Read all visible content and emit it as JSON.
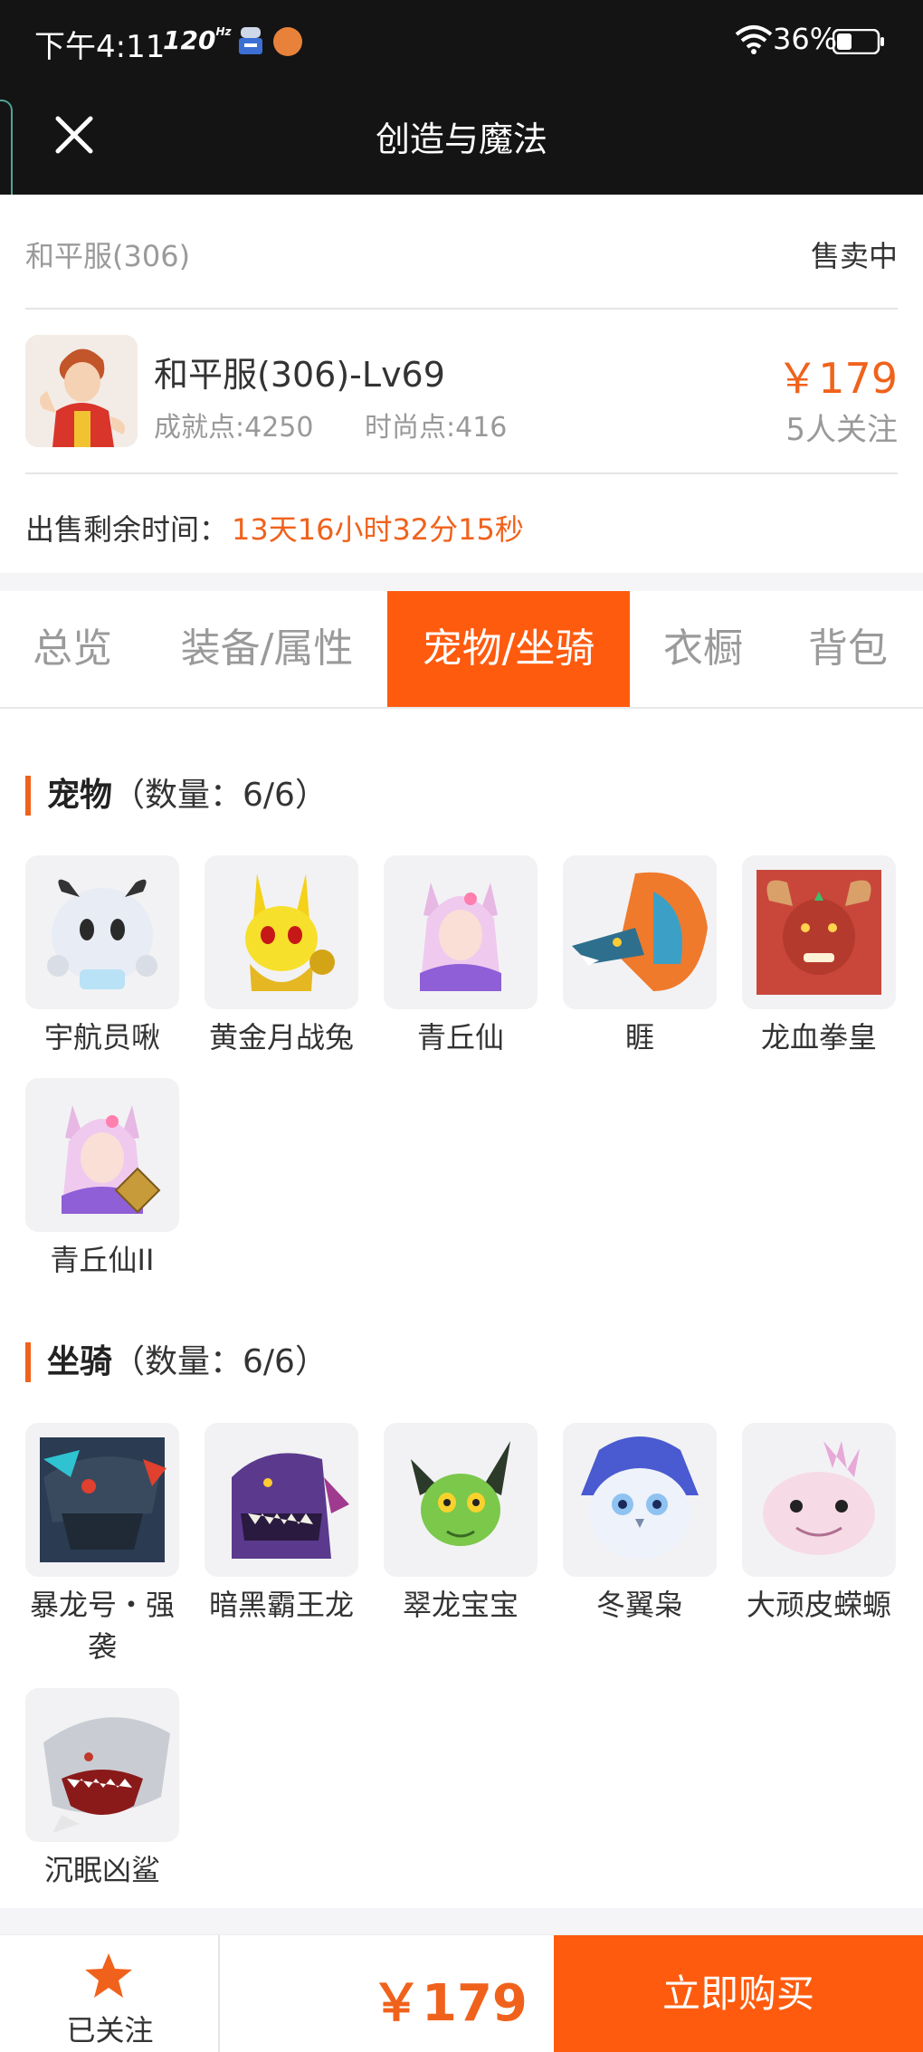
{
  "status_bar": {
    "time": "下午4:11",
    "refresh_rate": "120",
    "refresh_rate_sup": "Hz",
    "battery": "36%"
  },
  "nav": {
    "title": "创造与魔法",
    "close_icon": "close-icon"
  },
  "listing": {
    "server": "和平服(306)",
    "status": "售卖中",
    "character_name": "和平服(306)-Lv69",
    "achievement": "成就点:4250",
    "fashion": "时尚点:416",
    "price": "￥179",
    "followers": "5人关注",
    "remain_label": "出售剩余时间：",
    "remain_value": "13天16小时32分15秒"
  },
  "tabs": [
    {
      "label": "总览",
      "active": false
    },
    {
      "label": "装备/属性",
      "active": false
    },
    {
      "label": "宠物/坐骑",
      "active": true
    },
    {
      "label": "衣橱",
      "active": false
    },
    {
      "label": "背包",
      "active": false
    }
  ],
  "pets": {
    "title": "宠物",
    "count": "（数量：6/6）",
    "items": [
      {
        "name": "宇航员啾"
      },
      {
        "name": "黄金月战兔"
      },
      {
        "name": "青丘仙"
      },
      {
        "name": "睚"
      },
      {
        "name": "龙血拳皇"
      },
      {
        "name": "青丘仙II",
        "badge": "II"
      }
    ]
  },
  "mounts": {
    "title": "坐骑",
    "count": "（数量：6/6）",
    "items": [
      {
        "name": "暴龙号・强袭"
      },
      {
        "name": "暗黑霸王龙"
      },
      {
        "name": "翠龙宝宝"
      },
      {
        "name": "冬翼枭"
      },
      {
        "name": "大顽皮蝾螈"
      },
      {
        "name": "沉眠凶鲨"
      }
    ]
  },
  "bottom": {
    "follow_label": "已关注",
    "price": "￥179",
    "buy_label": "立即购买"
  },
  "colors": {
    "accent": "#ff5b0e",
    "price": "#f0621c",
    "header_bg": "#141414"
  }
}
